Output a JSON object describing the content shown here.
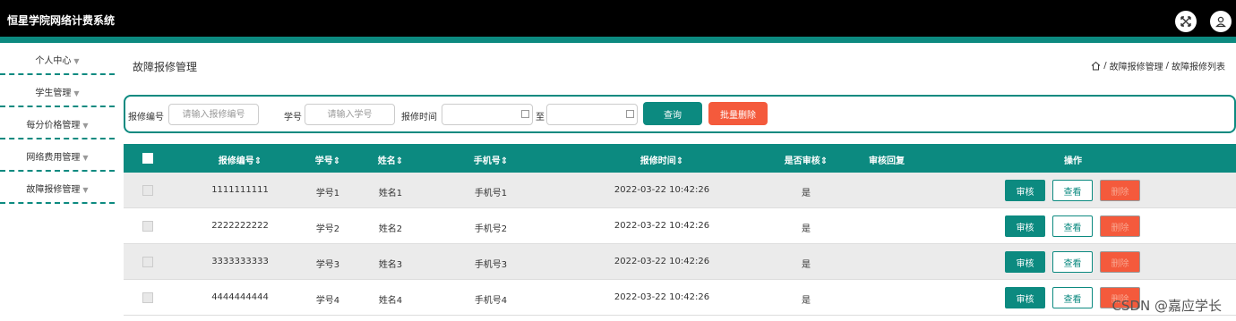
{
  "app": {
    "title": "恒星学院网络计费系统"
  },
  "colors": {
    "accent": "#0c8a80",
    "danger": "#f45a3c",
    "topbar": "#000000"
  },
  "icons": {
    "fullscreen": "expand-icon",
    "user": "user-icon",
    "home": "home-icon",
    "calendar": "calendar-icon"
  },
  "sidebar": {
    "items": [
      {
        "label": "个人中心"
      },
      {
        "label": "学生管理"
      },
      {
        "label": "每分价格管理"
      },
      {
        "label": "网络费用管理"
      },
      {
        "label": "故障报修管理"
      }
    ]
  },
  "page": {
    "title": "故障报修管理",
    "breadcrumb": [
      "故障报修管理",
      "故障报修列表"
    ],
    "breadcrumb_sep": "/"
  },
  "search": {
    "repair_no_label": "报修编号",
    "repair_no_placeholder": "请输入报修编号",
    "student_no_label": "学号",
    "student_no_placeholder": "请输入学号",
    "repair_time_label": "报修时间",
    "range_to": "至",
    "query_label": "查询",
    "batch_delete_label": "批量删除"
  },
  "table": {
    "headers": [
      "报修编号⇕",
      "学号⇕",
      "姓名⇕",
      "手机号⇕",
      "报修时间⇕",
      "是否审核⇕",
      "审核回复",
      "操作"
    ],
    "actions": {
      "audit": "审核",
      "view": "查看",
      "delete": "删除"
    },
    "rows": [
      {
        "repair_no": "1111111111",
        "student_no": "学号1",
        "name": "姓名1",
        "phone": "手机号1",
        "time": "2022-03-22 10:42:26",
        "audited": "是",
        "reply": ""
      },
      {
        "repair_no": "2222222222",
        "student_no": "学号2",
        "name": "姓名2",
        "phone": "手机号2",
        "time": "2022-03-22 10:42:26",
        "audited": "是",
        "reply": ""
      },
      {
        "repair_no": "3333333333",
        "student_no": "学号3",
        "name": "姓名3",
        "phone": "手机号3",
        "time": "2022-03-22 10:42:26",
        "audited": "是",
        "reply": ""
      },
      {
        "repair_no": "4444444444",
        "student_no": "学号4",
        "name": "姓名4",
        "phone": "手机号4",
        "time": "2022-03-22 10:42:26",
        "audited": "是",
        "reply": ""
      }
    ]
  },
  "watermark": "CSDN @嘉应学长"
}
